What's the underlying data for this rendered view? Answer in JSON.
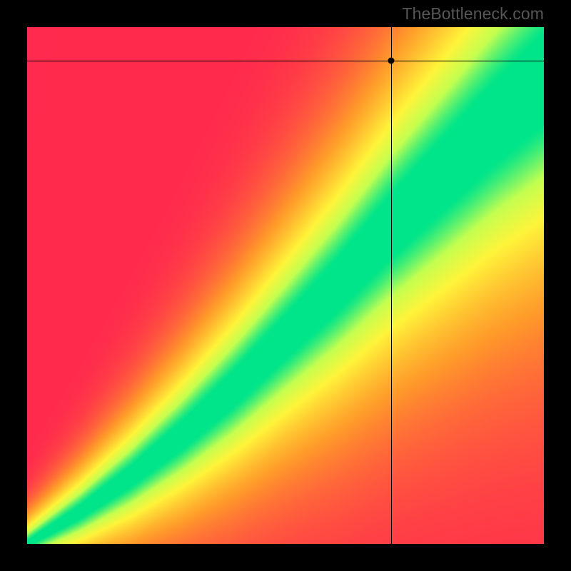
{
  "watermark": "TheBottleneck.com",
  "chart_data": {
    "type": "heatmap",
    "title": "",
    "xlabel": "",
    "ylabel": "",
    "xlim": [
      0,
      1
    ],
    "ylim": [
      0,
      1
    ],
    "grid": false,
    "legend": false,
    "colormap_description": "red → orange → yellow → green; green along a slightly super-linear diagonal ridge from bottom-left to top-right",
    "ridge_curve": {
      "description": "center of green band as y(x) in normalized [0,1] coords",
      "points": [
        {
          "x": 0.0,
          "y": 0.0
        },
        {
          "x": 0.1,
          "y": 0.06
        },
        {
          "x": 0.2,
          "y": 0.13
        },
        {
          "x": 0.3,
          "y": 0.21
        },
        {
          "x": 0.4,
          "y": 0.3
        },
        {
          "x": 0.5,
          "y": 0.4
        },
        {
          "x": 0.6,
          "y": 0.5
        },
        {
          "x": 0.7,
          "y": 0.61
        },
        {
          "x": 0.8,
          "y": 0.71
        },
        {
          "x": 0.9,
          "y": 0.81
        },
        {
          "x": 1.0,
          "y": 0.9
        }
      ],
      "band_halfwidth_at_x": [
        {
          "x": 0.0,
          "halfwidth": 0.005
        },
        {
          "x": 0.5,
          "halfwidth": 0.04
        },
        {
          "x": 1.0,
          "halfwidth": 0.085
        }
      ]
    },
    "crosshair": {
      "x": 0.705,
      "y": 0.935,
      "description": "black crosshair lines with filled dot at intersection"
    },
    "colors": {
      "red": "#ff2a4d",
      "orange": "#ff9a2a",
      "yellow": "#fff43a",
      "yellowgreen": "#c4ff50",
      "green": "#00e58a"
    }
  }
}
